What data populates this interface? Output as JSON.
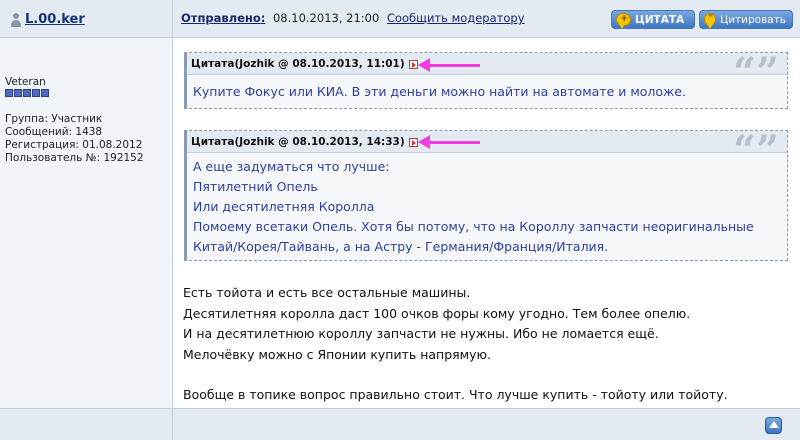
{
  "user": {
    "name": "L.00.ker",
    "rank": "Veteran",
    "stars": 5,
    "info": [
      "Группа: Участник",
      "Сообщений: 1438",
      "Регистрация: 01.08.2012",
      "Пользователь №: 192152"
    ]
  },
  "header": {
    "sent_label": "Отправлено:",
    "sent_date": "08.10.2013, 21:00",
    "report_link": "Сообщить модератору",
    "quote_button": "ЦИТАТА",
    "cite_button": "Цитировать"
  },
  "quotes": [
    {
      "title": "Цитата(Jozhik @ 08.10.2013, 11:01)",
      "lines": [
        "Купите Фокус или КИА. В эти деньги можно найти на автомате и моложе."
      ]
    },
    {
      "title": "Цитата(Jozhik @ 08.10.2013, 14:33)",
      "lines": [
        "А еще задуматься что лучше:",
        "Пятилетний Опель",
        "Или десятилетняя Королла",
        "Помоему всетаки Опель. Хотя бы потому, что на Короллу запчасти неоригинальные",
        "Китай/Корея/Тайвань, а на Астру - Германия/Франция/Италия."
      ]
    }
  ],
  "post": {
    "lines": [
      "Есть тойота и есть все остальные машины.",
      "Десятилетняя королла даст 100 очков форы кому угодно. Тем более опелю.",
      "И на десятилетнюю короллу запчасти не нужны. Ибо не ломается ещё.",
      "Мелочёвку можно с Японии купить напрямую.",
      "",
      "Вообще в топике вопрос правильно стоит. Что лучше купить - тойоту или тойоту."
    ]
  },
  "icons": {
    "user": "person-icon",
    "quote_jump": "quote-jump-icon",
    "quote_marks": "quote-marks-icon",
    "back_to_top": "arrow-up-icon"
  },
  "colors": {
    "header_bg": "#e4eaf2",
    "link": "#14286a",
    "quote_text": "#2c3f9c",
    "annotation_arrow": "#f03ce0",
    "button_blue": "#3f76c4"
  }
}
